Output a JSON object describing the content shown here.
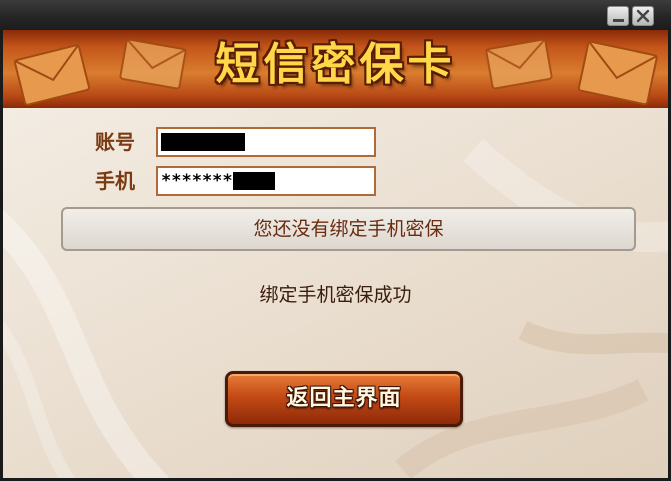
{
  "window": {
    "controls": {
      "minimize_icon": "minimize-icon",
      "close_icon": "close-icon"
    }
  },
  "banner": {
    "title": "短信密保卡",
    "decoration_icon": "envelope-icon"
  },
  "form": {
    "account_label": "账号",
    "account_value": "",
    "phone_label": "手机",
    "phone_value_visible": "*******"
  },
  "status": {
    "message": "您还没有绑定手机密保"
  },
  "result": {
    "message": "绑定手机密保成功"
  },
  "actions": {
    "return_label": "返回主界面"
  },
  "colors": {
    "banner": "#c4561a",
    "title_text": "#ffd84a",
    "label_text": "#7a3b12",
    "button": "#c44a16",
    "panel_bg": "#ede3d6"
  }
}
